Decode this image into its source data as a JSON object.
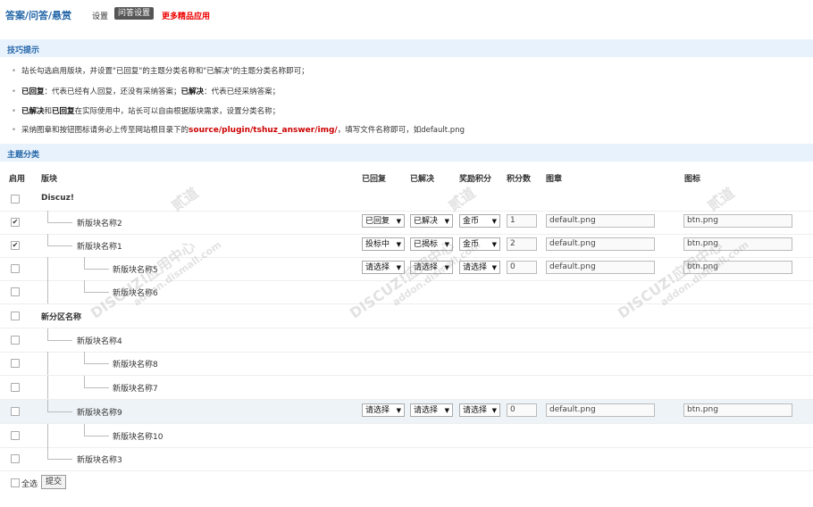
{
  "header": {
    "title": "答案/问答/悬赏",
    "nav_settings": "设置",
    "nav_qa": "问答设置",
    "nav_more": "更多精品应用"
  },
  "tips": {
    "heading": "技巧提示",
    "line1": "站长勾选启用版块，并设置\"已回复\"的主题分类名称和\"已解决\"的主题分类名称即可；",
    "line2_b1": "已回复",
    "line2_t1": "：代表已经有人回复，还没有采纳答案；",
    "line2_b2": "已解决",
    "line2_t2": "：代表已经采纳答案；",
    "line3_b1": "已解决",
    "line3_t1": "和",
    "line3_b2": "已回复",
    "line3_t2": "在实际使用中，站长可以自由根据版块需求，设置分类名称；",
    "line4_t1": "采纳图章和按钮图标请务必上传至网站根目录下的",
    "line4_path": "source/plugin/tshuz_answer/img/",
    "line4_t2": "，填写文件名称即可，如default.png"
  },
  "categories": {
    "heading": "主题分类",
    "columns": {
      "enable": "启用",
      "forum": "版块",
      "replied": "已回复",
      "solved": "已解决",
      "reward": "奖励积分",
      "points": "积分数",
      "stamp": "图章",
      "icon": "图标"
    },
    "rows": [
      {
        "name": "Discuz!",
        "checked": false
      },
      {
        "name": "新版块名称2",
        "checked": true,
        "replied": "已回复",
        "solved": "已解决",
        "reward": "金币",
        "points": "1",
        "stamp": "default.png",
        "icon": "btn.png"
      },
      {
        "name": "新版块名称1",
        "checked": true,
        "replied": "投标中",
        "solved": "已揭标",
        "reward": "金币",
        "points": "2",
        "stamp": "default.png",
        "icon": "btn.png"
      },
      {
        "name": "新版块名称5",
        "checked": false,
        "replied": "请选择",
        "solved": "请选择",
        "reward": "请选择",
        "points": "0",
        "stamp": "default.png",
        "icon": "btn.png"
      },
      {
        "name": "新版块名称6",
        "checked": false
      },
      {
        "name": "新分区名称",
        "checked": false
      },
      {
        "name": "新版块名称4",
        "checked": false
      },
      {
        "name": "新版块名称8",
        "checked": false
      },
      {
        "name": "新版块名称7",
        "checked": false
      },
      {
        "name": "新版块名称9",
        "checked": false,
        "replied": "请选择",
        "solved": "请选择",
        "reward": "请选择",
        "points": "0",
        "stamp": "default.png",
        "icon": "btn.png"
      },
      {
        "name": "新版块名称10",
        "checked": false
      },
      {
        "name": "新版块名称3",
        "checked": false
      }
    ],
    "checkmark": "✔",
    "select_arrow": "▼"
  },
  "footer": {
    "select_all": "全选",
    "submit": "提交"
  },
  "watermark": {
    "text1": "DISCUZ!应用中心",
    "text2": "addon.dismall.com",
    "text3": "贰道"
  }
}
